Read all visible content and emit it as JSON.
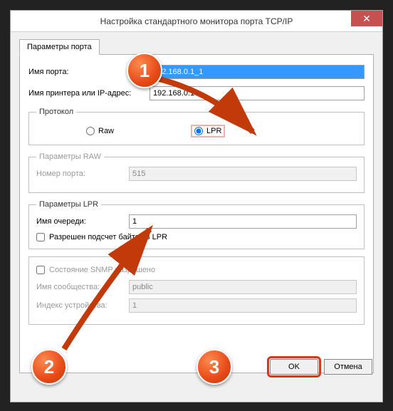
{
  "window": {
    "title": "Настройка стандартного монитора порта TCP/IP",
    "close_glyph": "✕"
  },
  "tab": {
    "label": "Параметры порта"
  },
  "fields": {
    "port_name_label": "Имя порта:",
    "port_name_value": "192.168.0.1_1",
    "printer_label": "Имя принтера или IP-адрес:",
    "printer_value": "192.168.0.1"
  },
  "protocol": {
    "legend": "Протокол",
    "raw_label": "Raw",
    "lpr_label": "LPR",
    "selected": "lpr"
  },
  "raw_group": {
    "legend": "Параметры RAW",
    "port_number_label": "Номер порта:",
    "port_number_value": "515"
  },
  "lpr_group": {
    "legend": "Параметры LPR",
    "queue_label": "Имя очереди:",
    "queue_value": "1",
    "count_label": "Разрешен подсчет байтов в LPR"
  },
  "snmp_group": {
    "enable_label": "Состояние SNMP разрешено",
    "community_label": "Имя сообщества:",
    "community_value": "public",
    "device_index_label": "Индекс устройства:",
    "device_index_value": "1"
  },
  "buttons": {
    "ok": "OK",
    "cancel": "Отмена"
  },
  "badges": {
    "b1": "1",
    "b2": "2",
    "b3": "3"
  }
}
